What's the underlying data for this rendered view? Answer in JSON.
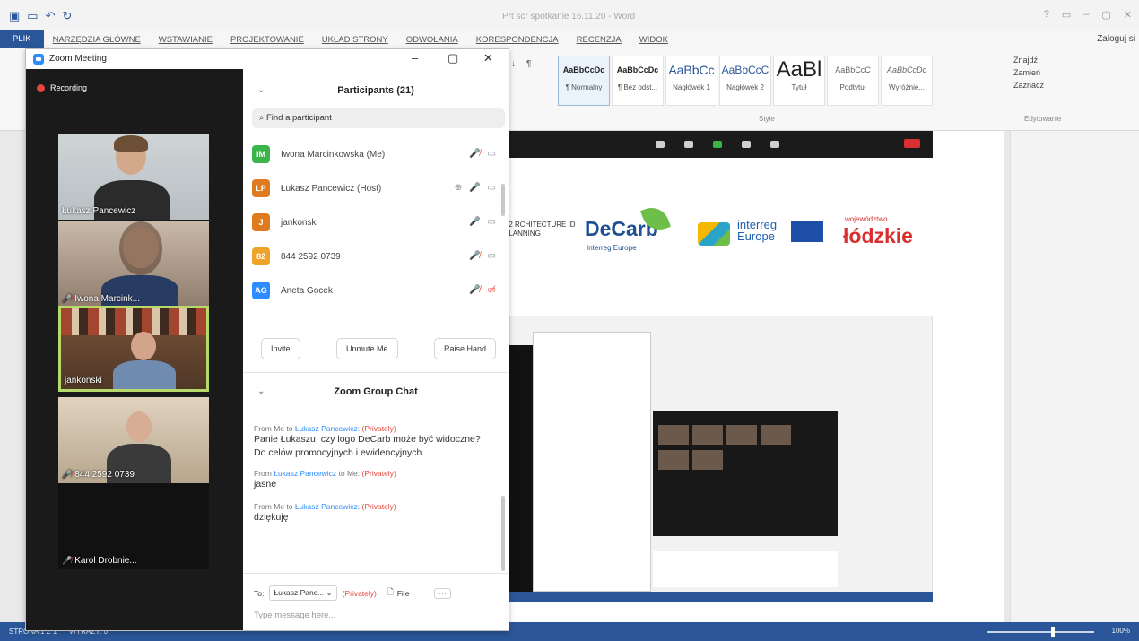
{
  "word": {
    "title": "Prt scr spotkanie 16.11.20 - Word",
    "login": "Zaloguj si",
    "menu": [
      "PLIK",
      "NARZĘDZIA GŁÓWNE",
      "WSTAWIANIE",
      "PROJEKTOWANIE",
      "UKŁAD STRONY",
      "ODWOŁANIA",
      "KORESPONDENCJA",
      "RECENZJA",
      "WIDOK"
    ],
    "styles": [
      {
        "sample": "AaBbCcDc",
        "name": "¶ Normalny"
      },
      {
        "sample": "AaBbCcDc",
        "name": "¶ Bez odst..."
      },
      {
        "sample": "AaBbCc",
        "name": "Nagłówek 1"
      },
      {
        "sample": "AaBbCcC",
        "name": "Nagłówek 2"
      },
      {
        "sample": "AaBl",
        "name": "Tytuł"
      },
      {
        "sample": "AaBbCcC",
        "name": "Podtytuł"
      },
      {
        "sample": "AaBbCcDc",
        "name": "Wyróżnie..."
      }
    ],
    "styles_group": "Style",
    "edit_group": "Edytowanie",
    "edit_items": [
      "Znajdź",
      "Zamień",
      "Zaznacz"
    ],
    "status": {
      "page": "STRONA 1 Z 1",
      "words": "WYRAZY: 0",
      "zoom": "100%"
    }
  },
  "slide": {
    "decarb": "DeCarb",
    "decarb_sub": "Interreg Europe",
    "interreg": "interreg Europe",
    "lodzkie_top": "województwo",
    "lodzkie": "łódzkie",
    "left_text": "P2 RCHITECTURE ID PLANNING"
  },
  "zoom": {
    "window_title": "Zoom Meeting",
    "recording": "Recording",
    "tiles": [
      {
        "label": "Łukasz Pancewicz",
        "muted": false
      },
      {
        "label": "Iwona Marcink...",
        "muted": true
      },
      {
        "label": "jankonski",
        "muted": false
      },
      {
        "label": "844 2592 0739",
        "muted": true
      },
      {
        "label": "Karol Drobnie...",
        "muted": true
      }
    ],
    "participants": {
      "title": "Participants (21)",
      "search_placeholder": "Find a participant",
      "list": [
        {
          "initials": "IM",
          "color": "#3ab54a",
          "name": "Iwona Marcinkowska (Me)",
          "mic": "muted",
          "cam": "on"
        },
        {
          "initials": "LP",
          "color": "#e07a1f",
          "name": "Łukasz Pancewicz (Host)",
          "mic": "on",
          "cam": "on"
        },
        {
          "initials": "J",
          "color": "#e07a1f",
          "name": "jankonski",
          "mic": "on",
          "cam": "on"
        },
        {
          "initials": "82",
          "color": "#f0a32a",
          "name": "844 2592 0739",
          "mic": "muted",
          "cam": "on"
        },
        {
          "initials": "AG",
          "color": "#2d8cff",
          "name": "Aneta Gocek",
          "mic": "muted",
          "cam": "off"
        }
      ],
      "buttons": [
        "Invite",
        "Unmute Me",
        "Raise Hand"
      ]
    },
    "chat": {
      "title": "Zoom Group Chat",
      "messages": [
        {
          "from": "From Me to",
          "who": "Łukasz Pancewicz:",
          "priv": "(Privately)",
          "text": "Panie Łukaszu, czy logo DeCarb może być widoczne?\nDo celów promocyjnych i ewidencyjnych"
        },
        {
          "from": "From",
          "who": "Łukasz Pancewicz",
          "to": "to Me:",
          "priv": "(Privately)",
          "text": "jasne"
        },
        {
          "from": "From Me to",
          "who": "Łukasz Pancewicz:",
          "priv": "(Privately)",
          "text": "dziękuję"
        }
      ],
      "to_label": "To:",
      "to_value": "Łukasz Panc...",
      "to_priv": "(Privately)",
      "file": "File",
      "more": "···",
      "input_placeholder": "Type message here..."
    }
  }
}
